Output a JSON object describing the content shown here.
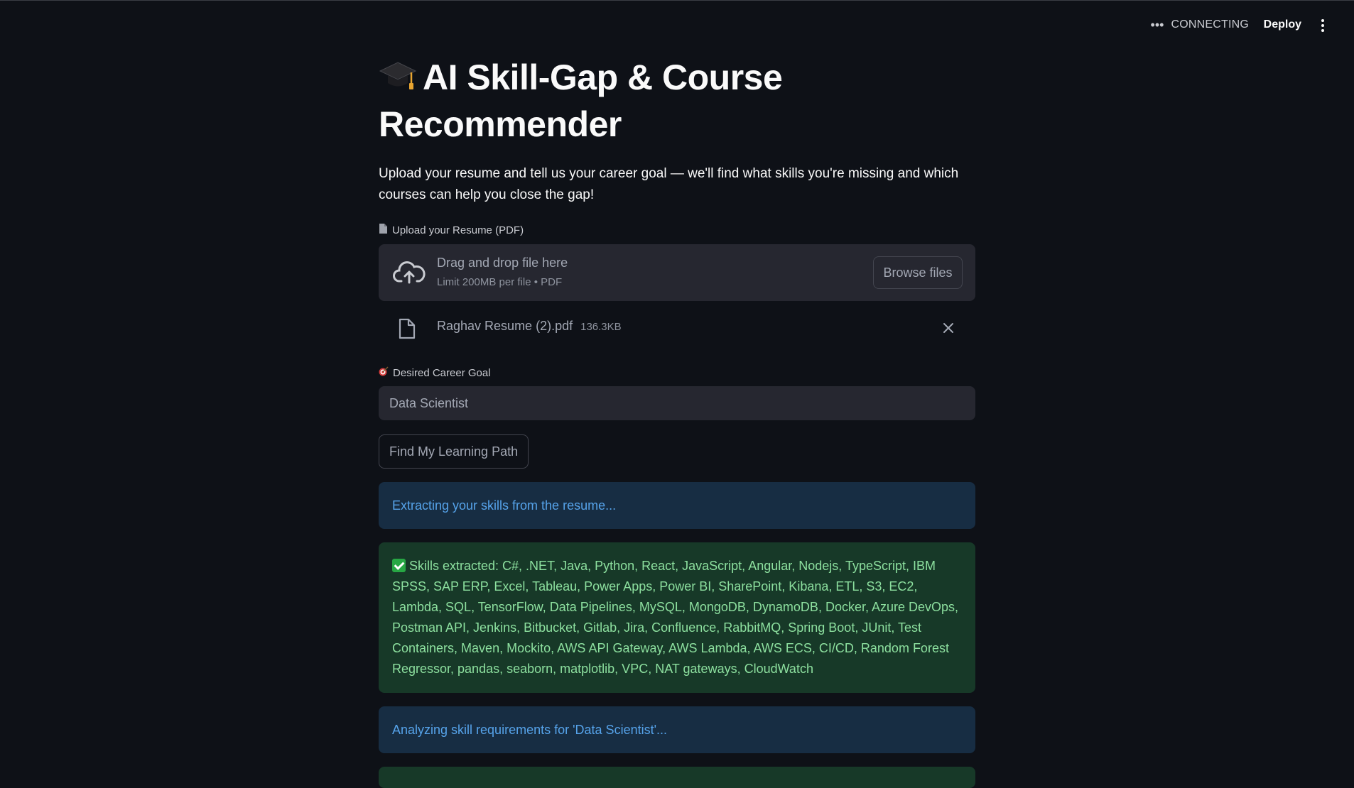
{
  "header": {
    "status_text": "CONNECTING",
    "deploy_label": "Deploy"
  },
  "main": {
    "title": "AI Skill-Gap & Course Recommender",
    "description": "Upload your resume and tell us your career goal — we'll find what skills you're missing and which courses can help you close the gap!",
    "upload": {
      "label": "Upload your Resume (PDF)",
      "drop_text": "Drag and drop file here",
      "limit_text": "Limit 200MB per file • PDF",
      "browse_label": "Browse files",
      "file_name": "Raghav Resume (2).pdf",
      "file_size": "136.3KB"
    },
    "goal": {
      "label": "Desired Career Goal",
      "value": "Data Scientist"
    },
    "find_button_label": "Find My Learning Path",
    "info_extracting": "Extracting your skills from the resume...",
    "skills_extracted": "Skills extracted: C#, .NET, Java, Python, React, JavaScript, Angular, Nodejs, TypeScript, IBM SPSS, SAP ERP, Excel, Tableau, Power Apps, Power BI, SharePoint, Kibana, ETL, S3, EC2, Lambda, SQL, TensorFlow, Data Pipelines, MySQL, MongoDB, DynamoDB, Docker, Azure DevOps, Postman API, Jenkins, Bitbucket, Gitlab, Jira, Confluence, RabbitMQ, Spring Boot, JUnit, Test Containers, Maven, Mockito, AWS API Gateway, AWS Lambda, AWS ECS, CI/CD, Random Forest Regressor, pandas, seaborn, matplotlib, VPC, NAT gateways, CloudWatch",
    "info_analyzing": "Analyzing skill requirements for 'Data Scientist'..."
  },
  "icons": {
    "title_icon": "graduation-cap-icon",
    "upload_label_icon": "page-icon",
    "goal_label_icon": "direct-hit-icon",
    "success_icon": "check-mark-button-icon"
  },
  "colors": {
    "background": "#0e1117",
    "info_bg": "#172d43",
    "info_text": "#56a3ea",
    "success_bg": "#173928",
    "success_text": "#8de09f"
  }
}
